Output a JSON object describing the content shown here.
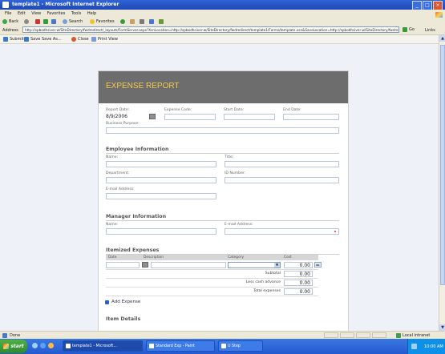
{
  "window": {
    "title": "template1 - Microsoft Internet Explorer"
  },
  "menubar": {
    "items": [
      "File",
      "Edit",
      "View",
      "Favorites",
      "Tools",
      "Help"
    ]
  },
  "toolbar": {
    "back": "Back",
    "search": "Search",
    "favorites": "Favorites"
  },
  "address": {
    "label": "Address",
    "url": "http://spbodhsiver-w/SiteDirectory/fwdredirect/_layouts/FormServer.aspx?XsnLocation=http://spbodhsiver-w/SiteDirectory/fwdredirect/template1/Forms/template.xsn&SaveLocation=http://spbodhsiver-w/SiteDirectory/fwdredirect/template1",
    "go": "Go",
    "links": "Links"
  },
  "formtoolbar": {
    "submit": "Submit",
    "save": "Save",
    "save_as": "Save As...",
    "close": "Close",
    "print_view": "Print View"
  },
  "form": {
    "title": "EXPENSE REPORT",
    "report_date_label": "Report Date:",
    "report_date_value": "8/9/2006",
    "expense_code_label": "Expense Code:",
    "start_date_label": "Start Date:",
    "end_date_label": "End Date:",
    "business_purpose_label": "Business Purpose:",
    "employee_section": "Employee Information",
    "name_label": "Name:",
    "title_label": "Title:",
    "department_label": "Department:",
    "id_number_label": "ID Number:",
    "email_label": "E-mail Address:",
    "manager_section": "Manager Information",
    "manager_name_label": "Name:",
    "manager_email_label": "E-mail Address:",
    "itemized_section": "Itemized Expenses",
    "col_date": "Date",
    "col_description": "Description",
    "col_category": "Category",
    "col_cost": "Cost",
    "row_cost": "0.00",
    "subtotal_label": "Subtotal",
    "subtotal_value": "0.00",
    "less_cash_label": "Less cash advance",
    "less_cash_value": "0.00",
    "total_label": "Total expenses",
    "total_value": "0.00",
    "add_expense": "Add Expense",
    "item_details": "Item Details"
  },
  "statusbar": {
    "status": "Done",
    "zone": "Local intranet"
  },
  "taskbar": {
    "start": "start",
    "tasks": [
      "template1 - Microsoft...",
      "Standard Exp - Paint",
      "U Step"
    ],
    "clock": "10:00 AM"
  }
}
